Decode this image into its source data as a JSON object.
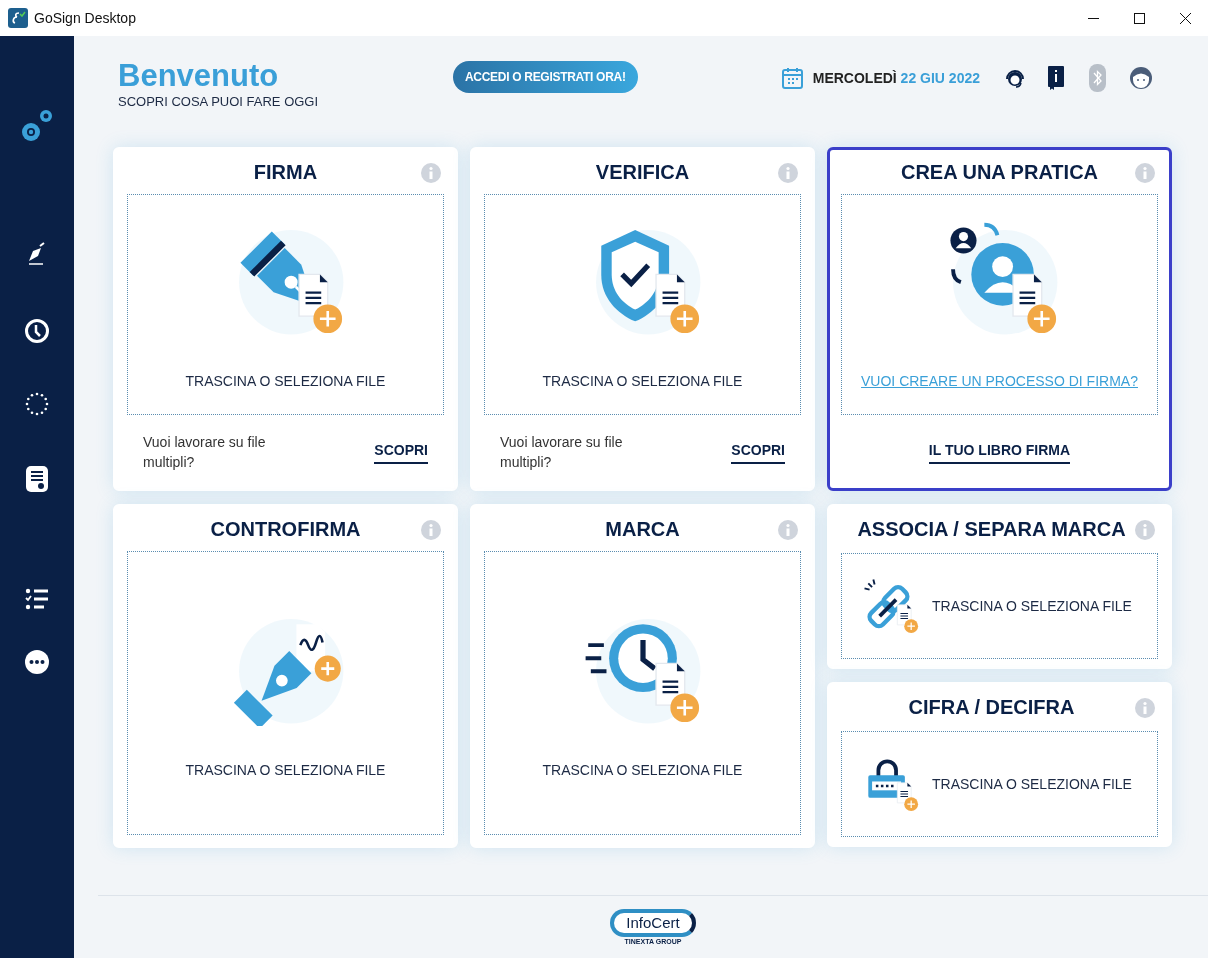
{
  "window": {
    "title": "GoSign Desktop"
  },
  "header": {
    "title": "Benvenuto",
    "subtitle": "SCOPRI COSA PUOI FARE OGGI",
    "login_button": "ACCEDI O REGISTRATI ORA!",
    "weekday": "MERCOLEDÌ",
    "date": "22 GIU 2022"
  },
  "cards": [
    {
      "kind": "large",
      "title": "FIRMA",
      "selected": false,
      "drop_text": "TRASCINA O SELEZIONA FILE",
      "footer_text": "Vuoi lavorare su file multipli?",
      "footer_link": "SCOPRI"
    },
    {
      "kind": "large",
      "title": "VERIFICA",
      "selected": false,
      "drop_text": "TRASCINA O SELEZIONA FILE",
      "footer_text": "Vuoi lavorare su file multipli?",
      "footer_link": "SCOPRI"
    },
    {
      "kind": "large",
      "title": "CREA UNA PRATICA",
      "selected": true,
      "drop_link": "VUOI CREARE UN PROCESSO DI FIRMA?",
      "footer_link": "IL TUO LIBRO FIRMA"
    },
    {
      "kind": "large",
      "title": "CONTROFIRMA",
      "selected": false,
      "drop_text": "TRASCINA O SELEZIONA FILE"
    },
    {
      "kind": "large",
      "title": "MARCA",
      "selected": false,
      "drop_text": "TRASCINA O SELEZIONA FILE"
    },
    {
      "kind": "compact",
      "title": "ASSOCIA / SEPARA MARCA",
      "selected": false,
      "drop_text": "TRASCINA O SELEZIONA FILE"
    },
    {
      "kind": "compact",
      "title": "CIFRA / DECIFRA",
      "selected": false,
      "drop_text": "TRASCINA O SELEZIONA FILE"
    }
  ],
  "footer": {
    "logo": "InfoCert",
    "tagline": "TINEXTA GROUP"
  }
}
